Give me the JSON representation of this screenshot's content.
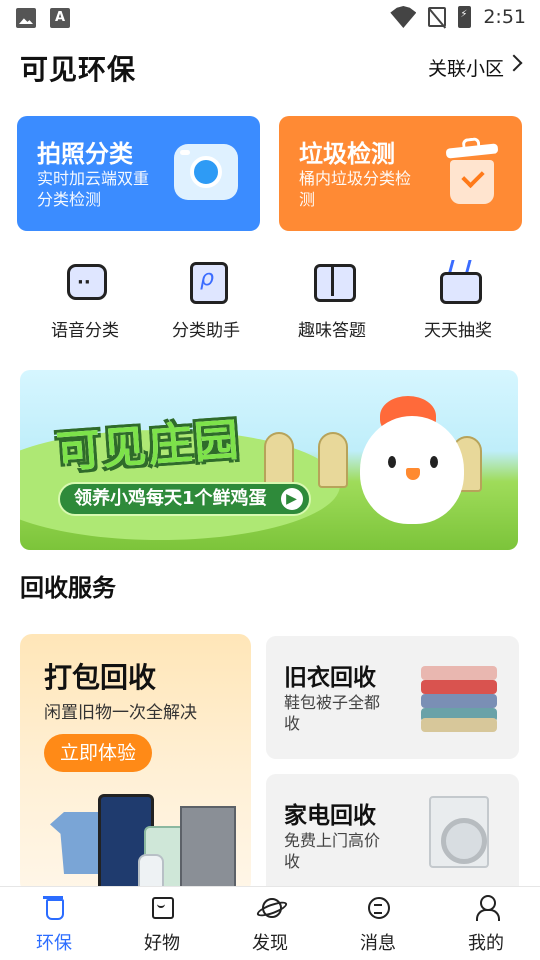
{
  "status_bar": {
    "time": "2:51",
    "left_icons": [
      "image-icon",
      "a-icon"
    ],
    "right_icons": [
      "wifi-icon",
      "no-sim-icon",
      "battery-charging-icon"
    ]
  },
  "header": {
    "title": "可见环保",
    "link_label": "关联小区"
  },
  "feature_cards": [
    {
      "title": "拍照分类",
      "subtitle": "实时加云端双重分类检测",
      "icon": "camera-icon",
      "color": "#3b8cff"
    },
    {
      "title": "垃圾检测",
      "subtitle": "桶内垃圾分类检测",
      "icon": "trash-bin-check-icon",
      "color": "#ff8a34"
    }
  ],
  "quick_actions": [
    {
      "label": "语音分类",
      "icon": "voice-chat-icon"
    },
    {
      "label": "分类助手",
      "icon": "assistant-icon"
    },
    {
      "label": "趣味答题",
      "icon": "quiz-book-icon"
    },
    {
      "label": "天天抽奖",
      "icon": "lottery-box-icon"
    }
  ],
  "banner": {
    "title": "可见庄园",
    "pill_text": "领养小鸡每天1个鲜鸡蛋"
  },
  "section_title": "回收服务",
  "recycle": {
    "main": {
      "title": "打包回收",
      "subtitle": "闲置旧物一次全解决",
      "button": "立即体验"
    },
    "items": [
      {
        "title": "旧衣回收",
        "subtitle": "鞋包被子全都收",
        "icon": "folded-clothes-icon"
      },
      {
        "title": "家电回收",
        "subtitle": "免费上门高价收",
        "icon": "washing-machine-icon"
      }
    ]
  },
  "tab_bar": {
    "active": "环保",
    "tabs": [
      {
        "label": "环保",
        "icon": "eco-cup-icon"
      },
      {
        "label": "好物",
        "icon": "shopping-bag-icon"
      },
      {
        "label": "发现",
        "icon": "planet-icon"
      },
      {
        "label": "消息",
        "icon": "message-icon"
      },
      {
        "label": "我的",
        "icon": "profile-icon"
      }
    ]
  },
  "colors": {
    "accent": "#2b6cff",
    "orange": "#ff8a17"
  }
}
